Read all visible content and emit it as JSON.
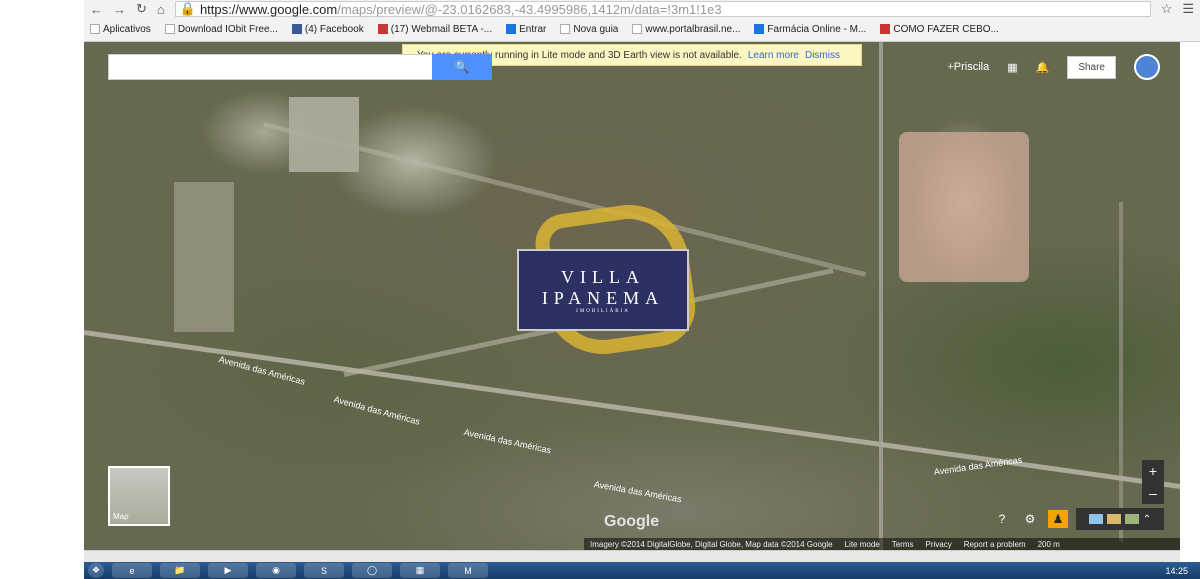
{
  "browser": {
    "url_main": "https://www.google.com",
    "url_rest": "/maps/preview/@-23.0162683,-43.4995986,1412m/data=!3m1!1e3",
    "bookmarks": [
      "Aplicativos",
      "Download IObit Free...",
      "(4) Facebook",
      "(17) Webmail BETA -...",
      "Entrar",
      "Nova guia",
      "www.portalbrasil.ne...",
      "Farmácia Online - M...",
      "COMO FAZER CEBO..."
    ]
  },
  "map": {
    "notice_text": "You are currently running in Lite mode and 3D Earth view is not available.",
    "notice_learn": "Learn more",
    "notice_dismiss": "Dismiss",
    "user_name": "+Priscila",
    "share_label": "Share",
    "logo_line1": "VILLA",
    "logo_line2": "IPANEMA",
    "logo_line3": "IMOBILIÁRIA",
    "road_labels": [
      "Avenida das Américas",
      "Avenida das Américas",
      "Avenida das Américas",
      "Avenida das Américas",
      "Avenida das Américas"
    ],
    "minimap_label": "Map",
    "google_logo": "Google",
    "footer": [
      "Imagery ©2014 DigitalGlobe, Digital Globe, Map data ©2014 Google",
      "Lite mode",
      "Terms",
      "Privacy",
      "Report a problem",
      "200 m"
    ]
  },
  "taskbar": {
    "clock": "14:25"
  }
}
